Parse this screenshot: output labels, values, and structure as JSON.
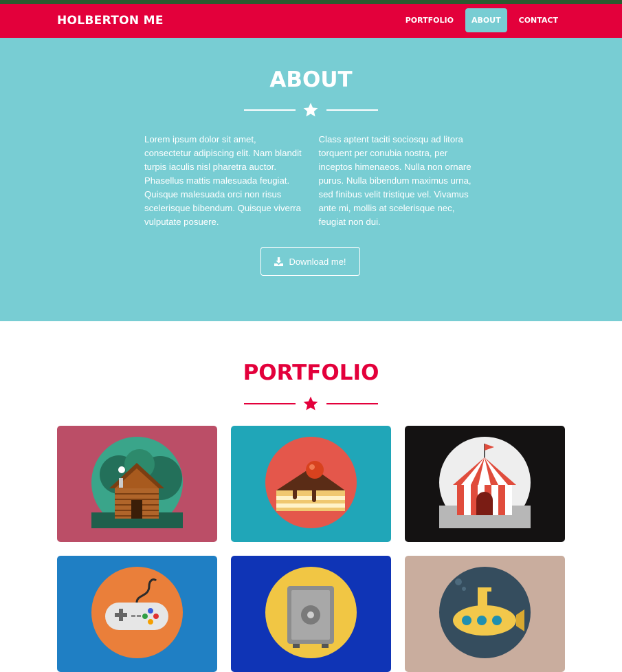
{
  "navbar": {
    "brand": "HOLBERTON ME",
    "links": [
      {
        "label": "PORTFOLIO",
        "active": false
      },
      {
        "label": "ABOUT",
        "active": true
      },
      {
        "label": "CONTACT",
        "active": false
      }
    ]
  },
  "about": {
    "title": "ABOUT",
    "left_text": "Lorem ipsum dolor sit amet, consectetur adipiscing elit. Nam blandit turpis iaculis nisl pharetra auctor. Phasellus mattis malesuada feugiat. Quisque malesuada orci non risus scelerisque bibendum. Quisque viverra vulputate posuere.",
    "right_text": "Class aptent taciti sociosqu ad litora torquent per conubia nostra, per inceptos himenaeos. Nulla non ornare purus. Nulla bibendum maximus urna, sed finibus velit tristique vel. Vivamus ante mi, mollis at scelerisque nec, feugiat non dui.",
    "download_label": "Download me!",
    "download_icon": "download-icon"
  },
  "portfolio": {
    "title": "PORTFOLIO",
    "items": [
      {
        "icon": "cabin-icon",
        "bg": "#bb4e67",
        "circle": "#3aa58a"
      },
      {
        "icon": "cake-icon",
        "bg": "#20a6b8",
        "circle": "#e4574b"
      },
      {
        "icon": "circus-tent-icon",
        "bg": "#141212",
        "circle": "#eeeeee"
      },
      {
        "icon": "game-controller-icon",
        "bg": "#1f7fc4",
        "circle": "#ea7f3a"
      },
      {
        "icon": "safe-icon",
        "bg": "#0f34b6",
        "circle": "#f1c644"
      },
      {
        "icon": "submarine-icon",
        "bg": "#c9ad9e",
        "circle": "#354d5e"
      }
    ]
  },
  "colors": {
    "primary": "#e3003b",
    "teal": "#78cdd3",
    "topstrip": "#2a5a2f"
  }
}
